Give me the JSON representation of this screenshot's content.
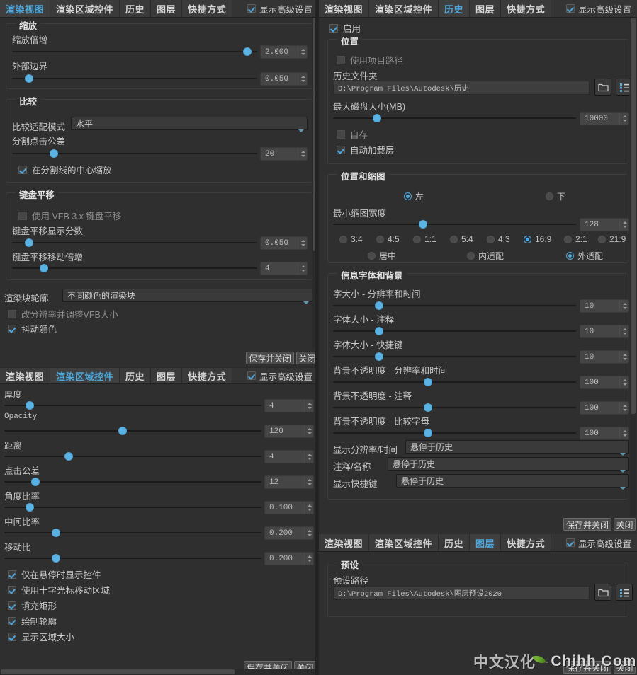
{
  "tabs": [
    "渲染视图",
    "渲染区域控件",
    "历史",
    "图层",
    "快捷方式"
  ],
  "advanced_label": "显示高级设置",
  "buttons": {
    "save_close": "保存并关闭",
    "close": "关闭"
  },
  "panel_render_view": {
    "active_tab": "渲染视图",
    "group_zoom": {
      "legend": "缩放",
      "rows": [
        {
          "label": "缩放倍增",
          "value": "2.000",
          "knob_pct": 96
        },
        {
          "label": "外部边界",
          "value": "0.050",
          "knob_pct": 7
        }
      ]
    },
    "group_compare": {
      "legend": "比较",
      "mode_label": "比较适配模式",
      "mode_value": "水平",
      "tolerance_label": "分割点击公差",
      "tolerance_value": "20",
      "tolerance_knob_pct": 17,
      "center_zoom_label": "在分割线的中心缩放",
      "center_zoom_checked": true
    },
    "group_pan": {
      "legend": "键盘平移",
      "use_vfb_label": "使用 VFB 3.x 键盘平移",
      "use_vfb_checked": false,
      "rows": [
        {
          "label": "键盘平移显示分数",
          "value": "0.050",
          "knob_pct": 7
        },
        {
          "label": "键盘平移移动倍增",
          "value": "4",
          "knob_pct": 13
        }
      ]
    },
    "outline_label": "渲染块轮廓",
    "outline_value": "不同颜色的渲染块",
    "resize_vfb_label": "改分辨率并调整VFB大小",
    "resize_vfb_checked": false,
    "dither_label": "抖动颜色",
    "dither_checked": true
  },
  "panel_region_control": {
    "active_tab": "渲染区域控件",
    "sliders": [
      {
        "label": "厚度",
        "value": "4",
        "knob_pct": 10,
        "mono": false
      },
      {
        "label": "Opacity",
        "value": "120",
        "knob_pct": 46,
        "mono": true
      },
      {
        "label": "距离",
        "value": "4",
        "knob_pct": 25,
        "mono": false
      },
      {
        "label": "点击公差",
        "value": "12",
        "knob_pct": 12,
        "mono": false
      },
      {
        "label": "角度比率",
        "value": "0.100",
        "knob_pct": 10,
        "mono": false
      },
      {
        "label": "中间比率",
        "value": "0.200",
        "knob_pct": 20,
        "mono": false
      },
      {
        "label": "移动比",
        "value": "0.200",
        "knob_pct": 20,
        "mono": false
      }
    ],
    "checks": [
      {
        "label": "仅在悬停时显示控件",
        "checked": true
      },
      {
        "label": "使用十字光标移动区域",
        "checked": true
      },
      {
        "label": "填充矩形",
        "checked": true
      },
      {
        "label": "绘制轮廓",
        "checked": true
      },
      {
        "label": "显示区域大小",
        "checked": true
      }
    ]
  },
  "panel_history": {
    "active_tab": "历史",
    "enable_label": "启用",
    "enable_checked": true,
    "group_location": {
      "legend": "位置",
      "use_project_path_label": "使用项目路径",
      "use_project_path_checked": false,
      "folder_label": "历史文件夹",
      "folder_path": "D:\\Program Files\\Autodesk\\历史",
      "max_disk_label": "最大磁盘大小(MB)",
      "max_disk_value": "10000",
      "max_disk_knob_pct": 18,
      "autosave_label": "自存",
      "autosave_checked": false,
      "autoload_label": "自动加载层",
      "autoload_checked": true
    },
    "group_position": {
      "legend": "位置和缩图",
      "pos_left_label": "左",
      "pos_bottom_label": "下",
      "pos_selected": "左",
      "min_thumb_label": "最小缩图宽度",
      "min_thumb_value": "128",
      "min_thumb_knob_pct": 37,
      "ratios": [
        "3:4",
        "4:5",
        "1:1",
        "5:4",
        "4:3",
        "16:9",
        "2:1",
        "21:9"
      ],
      "ratio_selected": "16:9",
      "fit_options": [
        "居中",
        "内适配",
        "外适配"
      ],
      "fit_selected": "外适配"
    },
    "group_info": {
      "legend": "信息字体和背景",
      "sliders": [
        {
          "label": "字大小 - 分辨率和时间",
          "value": "10",
          "knob_pct": 19
        },
        {
          "label": "字体大小 - 注释",
          "value": "10",
          "knob_pct": 19
        },
        {
          "label": "字体大小 - 快捷键",
          "value": "10",
          "knob_pct": 19
        },
        {
          "label": "背景不透明度 - 分辨率和时间",
          "value": "100",
          "knob_pct": 39
        },
        {
          "label": "背景不透明度 - 注释",
          "value": "100",
          "knob_pct": 39
        },
        {
          "label": "背景不透明度 - 比较字母",
          "value": "100",
          "knob_pct": 39
        }
      ],
      "combos": [
        {
          "label": "显示分辨率/时间",
          "value": "悬停于历史"
        },
        {
          "label": "注释/名称",
          "value": "悬停于历史"
        },
        {
          "label": "显示快捷键",
          "value": "悬停于历史"
        }
      ]
    }
  },
  "panel_layers": {
    "active_tab": "图层",
    "group_preset": {
      "legend": "预设",
      "path_label": "预设路径",
      "path_value": "D:\\Program Files\\Autodesk\\图层预设2020"
    }
  },
  "watermark": {
    "cn": "中文汉化",
    "sep": "-",
    "site": "Chihh.Com"
  },
  "icons": {
    "folder": "folder-icon",
    "list": "list-icon",
    "checkmark": "checkmark-icon",
    "dropdown": "chevron-down-icon"
  }
}
